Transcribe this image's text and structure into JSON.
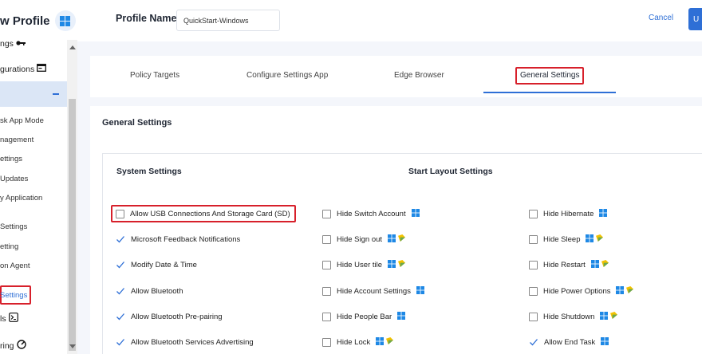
{
  "app": {
    "title": "w Profile"
  },
  "sidebar": {
    "items": [
      {
        "label": "ngs"
      },
      {
        "label": "gurations"
      },
      {
        "label": "sk App Mode"
      },
      {
        "label": "nagement"
      },
      {
        "label": "ettings"
      },
      {
        "label": "Updates"
      },
      {
        "label": "y Application"
      },
      {
        "label": "Settings"
      },
      {
        "label": "etting"
      },
      {
        "label": "on Agent"
      },
      {
        "label": "Settings"
      },
      {
        "label": "ls"
      },
      {
        "label": "ring"
      }
    ]
  },
  "header": {
    "profile_label": "Profile Name",
    "profile_value": "QuickStart-Windows",
    "cancel_label": "Cancel",
    "primary_label": "U"
  },
  "tabs": [
    {
      "label": "Policy Targets"
    },
    {
      "label": "Configure Settings App"
    },
    {
      "label": "Edge Browser"
    },
    {
      "label": "General Settings"
    }
  ],
  "content": {
    "section_title": "General Settings",
    "system_title": "System Settings",
    "start_title": "Start Layout Settings",
    "system_options": [
      {
        "label": "Allow USB Connections And Storage Card (SD)",
        "checked": false
      },
      {
        "label": "Microsoft Feedback Notifications",
        "checked": true
      },
      {
        "label": "Modify Date & Time",
        "checked": true
      },
      {
        "label": "Allow Bluetooth",
        "checked": true
      },
      {
        "label": "Allow Bluetooth Pre-pairing",
        "checked": true
      },
      {
        "label": "Allow Bluetooth Services Advertising",
        "checked": true
      }
    ],
    "start_col1": [
      {
        "label": "Hide Switch Account",
        "checked": false,
        "icons": [
          "windows-icon"
        ]
      },
      {
        "label": "Hide Sign out",
        "checked": false,
        "icons": [
          "windows-icon",
          "android-icon"
        ]
      },
      {
        "label": "Hide User tile",
        "checked": false,
        "icons": [
          "windows-icon",
          "android-icon"
        ]
      },
      {
        "label": "Hide Account Settings",
        "checked": false,
        "icons": [
          "windows-icon"
        ]
      },
      {
        "label": "Hide People Bar",
        "checked": false,
        "icons": [
          "windows-icon"
        ]
      },
      {
        "label": "Hide Lock",
        "checked": false,
        "icons": [
          "windows-icon",
          "android-icon"
        ]
      }
    ],
    "start_col2": [
      {
        "label": "Hide Hibernate",
        "checked": false,
        "icons": [
          "windows-icon"
        ]
      },
      {
        "label": "Hide Sleep",
        "checked": false,
        "icons": [
          "windows-icon",
          "android-icon"
        ]
      },
      {
        "label": "Hide Restart",
        "checked": false,
        "icons": [
          "windows-icon",
          "android-icon"
        ]
      },
      {
        "label": "Hide Power Options",
        "checked": false,
        "icons": [
          "windows-icon",
          "android-icon"
        ]
      },
      {
        "label": "Hide Shutdown",
        "checked": false,
        "icons": [
          "windows-icon",
          "android-icon"
        ]
      },
      {
        "label": "Allow End Task",
        "checked": true,
        "icons": [
          "windows-icon"
        ]
      }
    ]
  },
  "colors": {
    "accent": "#2e6fd6",
    "highlight_red": "#d7202b",
    "windows_blue": "#1e88e5",
    "badge_yellow": "#f2c200",
    "badge_green": "#6aa84f"
  }
}
